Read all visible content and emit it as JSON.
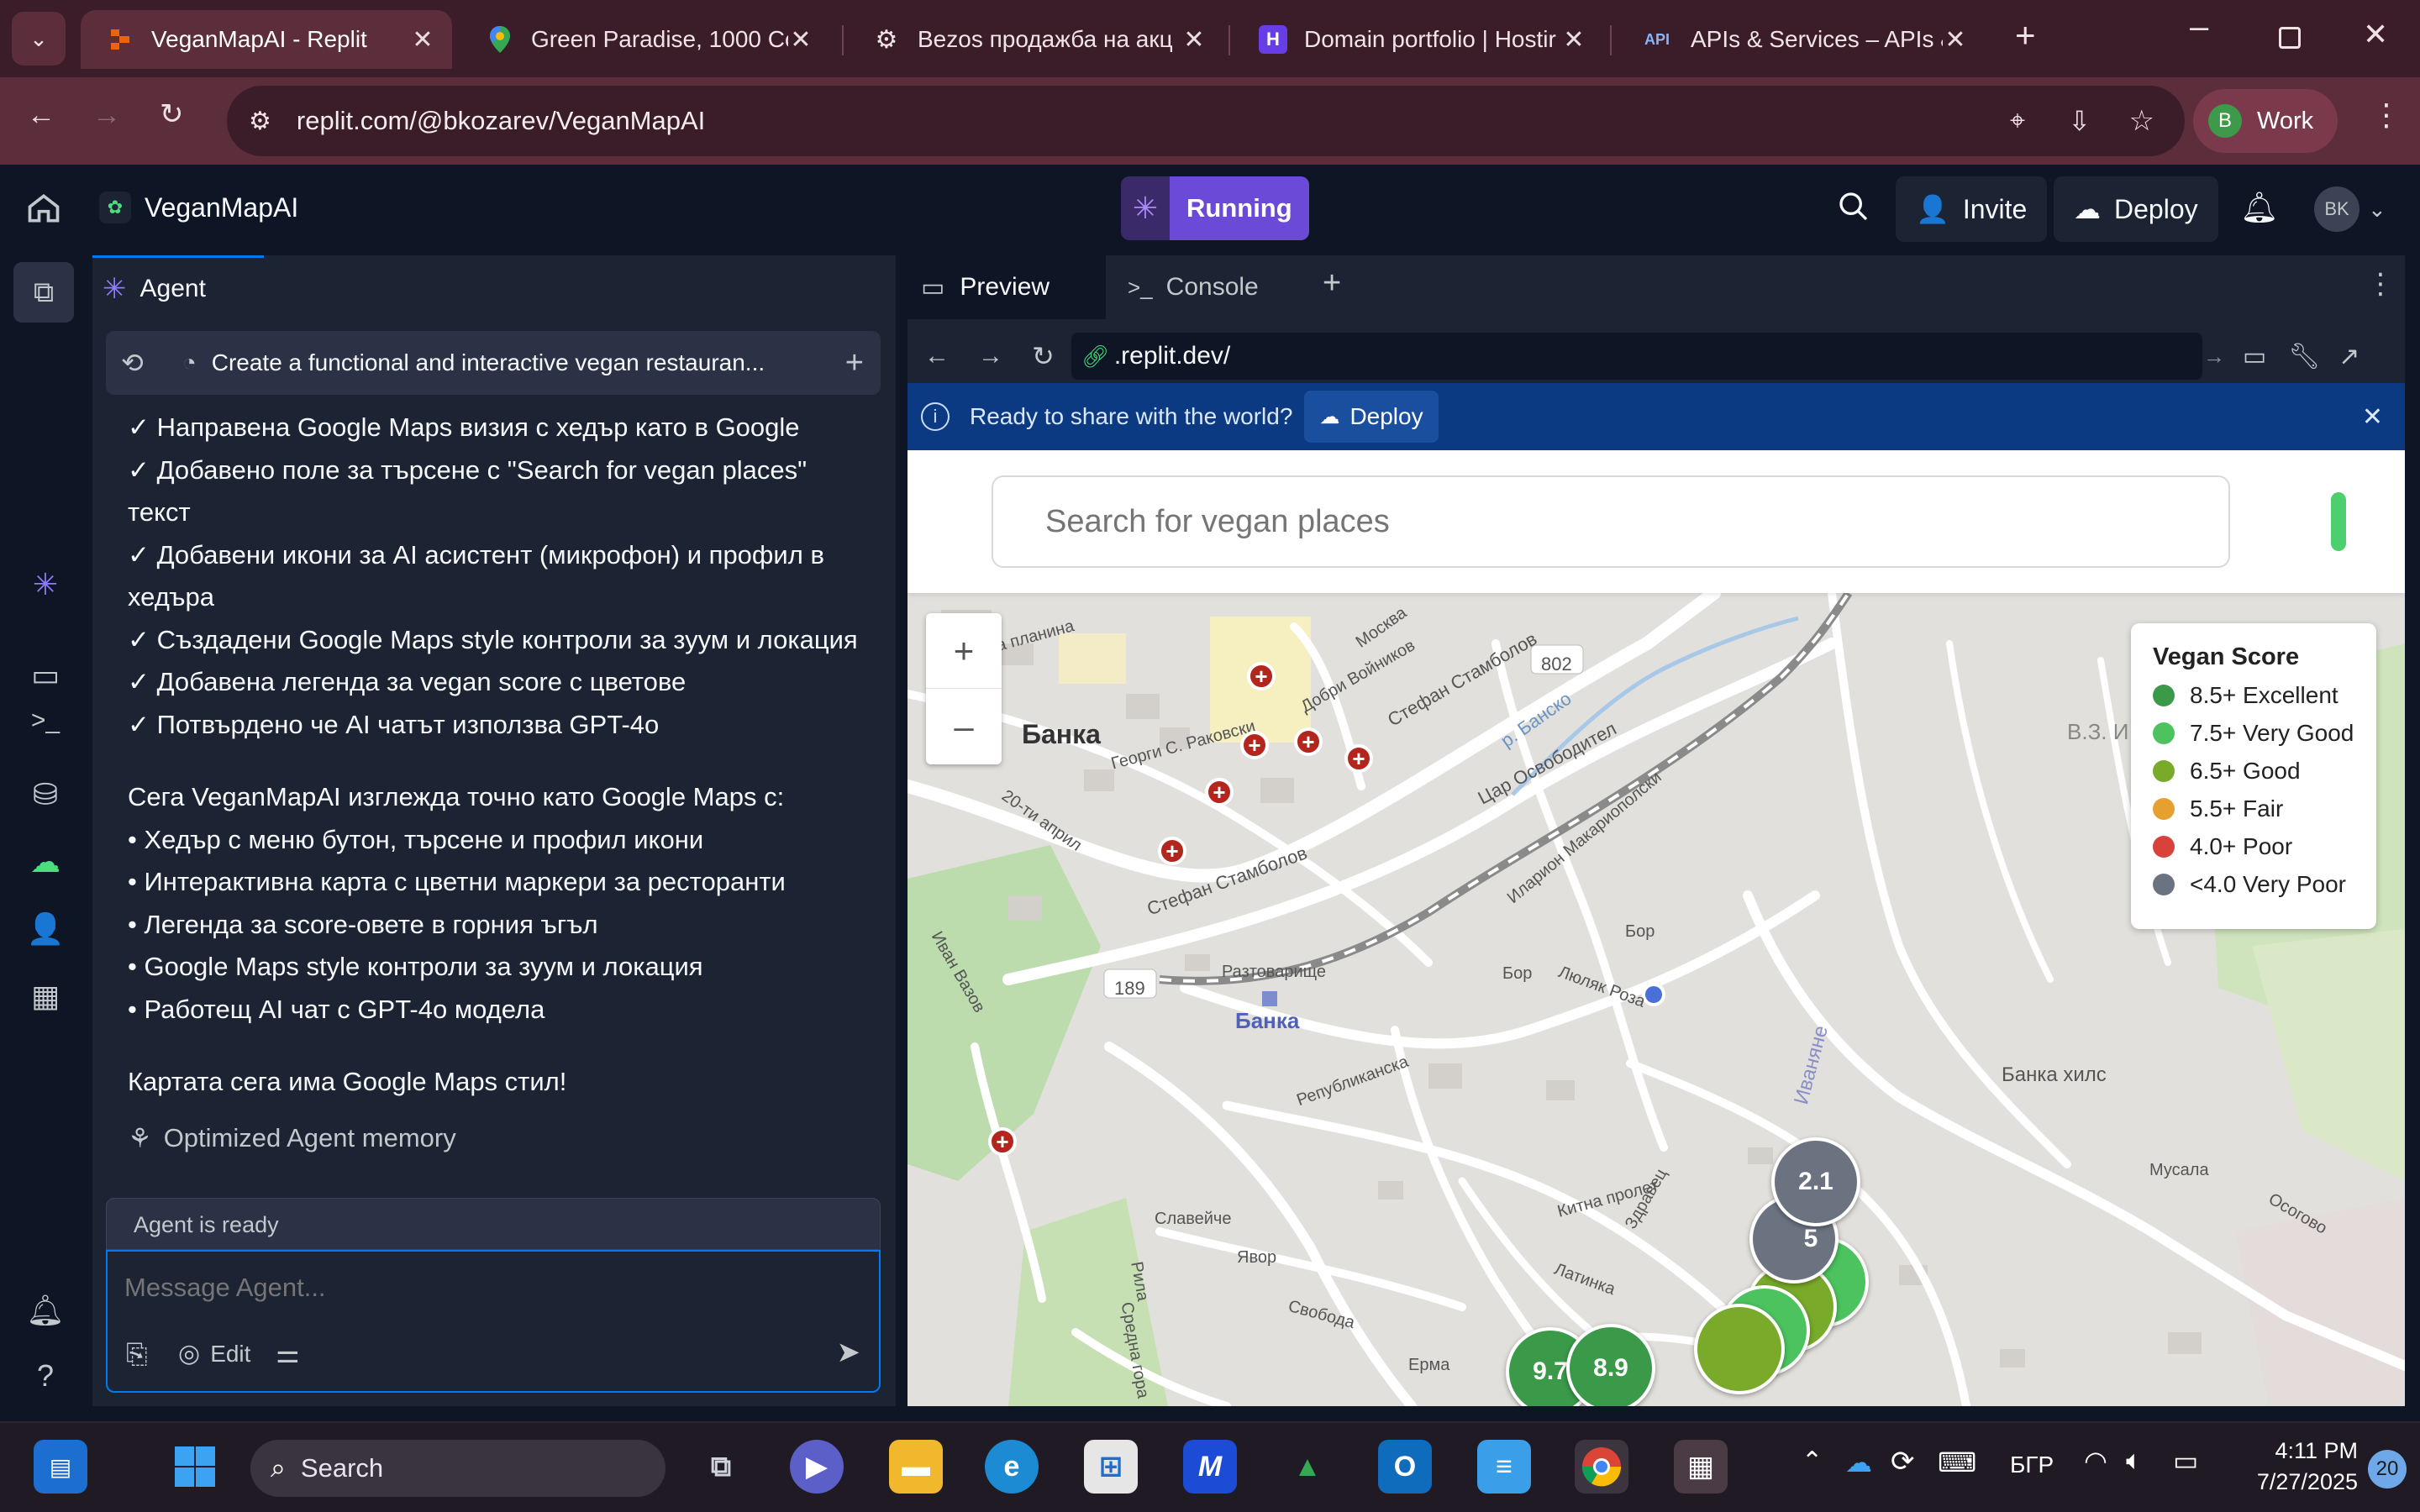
{
  "browser": {
    "tabs": [
      {
        "title": "VeganMapAI - Replit",
        "icon": "replit-icon",
        "active": true
      },
      {
        "title": "Green Paradise, 1000 Co",
        "icon": "maps-pin-icon",
        "active": false
      },
      {
        "title": "Bezos продажба на акц",
        "icon": "openai-icon",
        "active": false
      },
      {
        "title": "Domain portfolio | Hostir",
        "icon": "hostinger-icon",
        "active": false
      },
      {
        "title": "APIs & Services – APIs &",
        "icon": "api-icon",
        "active": false
      }
    ],
    "url": "replit.com/@bkozarev/VeganMapAI",
    "profile_initial": "B",
    "profile_label": "Work"
  },
  "header": {
    "project_name": "VeganMapAI",
    "run_status": "Running",
    "invite_label": "Invite",
    "deploy_label": "Deploy",
    "avatar_initials": "BK"
  },
  "agent": {
    "tab_label": "Agent",
    "task_title": "Create a functional and interactive vegan restauran...",
    "messages": [
      "✓ Направена Google Maps визия с хедър като в Google",
      "✓ Добавено поле за търсене с \"Search for vegan places\"",
      "текст",
      "✓ Добавени икони за AI асистент (микрофон) и профил в",
      "хедъра",
      "✓ Създадени Google Maps style контроли за зуум и локация",
      "✓ Добавена легенда за vegan score с цветове",
      "✓ Потвърдено че AI чатът използва GPT-4o"
    ],
    "summary_intro": "Сега VeganMapAI изглежда точно като Google Maps с:",
    "summary_items": [
      "• Хедър с меню бутон, търсене и профил икони",
      "• Интерактивна карта с цветни маркери за ресторанти",
      "• Легенда за score-овете в горния ъгъл",
      "• Google Maps style контроли за зуум и локация",
      "• Работещ AI чат с GPT-4o модела"
    ],
    "closing": "Картата сега има Google Maps стил!",
    "memory_note": "Optimized Agent memory",
    "status": "Agent is ready",
    "input_placeholder": "Message Agent...",
    "edit_label": "Edit"
  },
  "preview": {
    "tab_preview": "Preview",
    "tab_console": "Console",
    "url": ".replit.dev/",
    "banner_text": "Ready to share with the world?",
    "banner_deploy": "Deploy",
    "search_placeholder": "Search for vegan places",
    "legend": {
      "title": "Vegan Score",
      "items": [
        {
          "label": "8.5+ Excellent",
          "color": "#3a9a4a"
        },
        {
          "label": "7.5+ Very Good",
          "color": "#4cc35e"
        },
        {
          "label": "6.5+ Good",
          "color": "#7aaa2a"
        },
        {
          "label": "5.5+ Fair",
          "color": "#e6a030"
        },
        {
          "label": "4.0+ Poor",
          "color": "#d9413b"
        },
        {
          "label": "<4.0 Very Poor",
          "color": "#6b7280"
        }
      ]
    },
    "map_labels": {
      "district": "Банка",
      "station": "Банка",
      "hills": "Банка хилс",
      "ivanyane": "Иваняне",
      "road_802": "802",
      "road_189": "189",
      "stambolov1": "Стефан Стамболов",
      "stambolov2": "Стефан Стамболов",
      "osvoboditel": "Цар Освободител",
      "makariopolski": "Иларион Макариополски",
      "moskva": "Москва",
      "rakovski": "Георги С. Раковски",
      "vazov": "Иван Вазов",
      "republikanska": "Републиканска",
      "slavei": "Славейче",
      "yavor": "Явор",
      "svoboda": "Свобода",
      "kitka": "Китна пролет",
      "musala": "Мусала",
      "osogovo": "Осогово",
      "river": "р. Банско",
      "dobri": "Добри Войников",
      "lyulyak": "Люляк Роза",
      "bor1": "Бор",
      "bor2": "Бор",
      "latinka": "Латинка",
      "erma": "Ерма",
      "rila": "Рила",
      "sredna": "Средна гора",
      "zdravets": "Здравец",
      "razt": "Разтоварище",
      "stara": "Стара планина",
      "aprili": "20-ти април",
      "vz": "В.З. И"
    },
    "markers": [
      {
        "value": "2.1",
        "color": "#6b7280"
      },
      {
        "value": "5",
        "color": "#6b7280"
      },
      {
        "value": "9.7",
        "color": "#3a9a4a"
      },
      {
        "value": "8.9",
        "color": "#3a9a4a"
      }
    ]
  },
  "taskbar": {
    "search_label": "Search",
    "language": "БГР",
    "time": "4:11 PM",
    "date": "7/27/2025",
    "notification_count": "20"
  }
}
